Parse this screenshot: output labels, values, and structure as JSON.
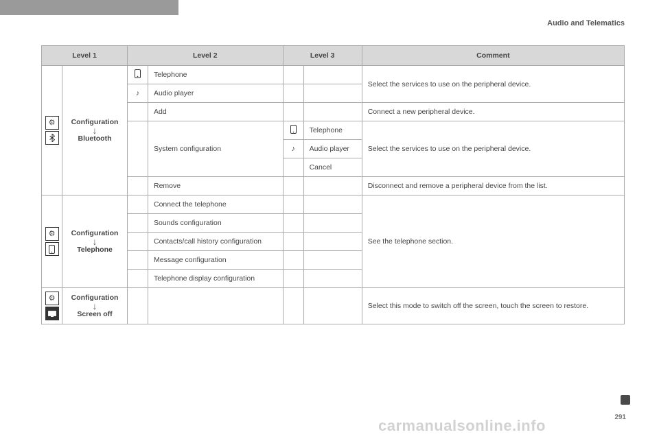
{
  "header": {
    "section": "Audio and Telematics"
  },
  "page_number": "291",
  "watermark": "carmanualsonline.info",
  "columns": {
    "c1": "Level 1",
    "c2": "Level 2",
    "c3": "Level 3",
    "c4": "Comment"
  },
  "groups": {
    "bt": {
      "label_top": "Configuration",
      "label_bottom": "Bluetooth",
      "icon_top": "gears-icon",
      "icon_bottom": "bluetooth-icon",
      "rows": {
        "r1": {
          "icon": "phone-icon",
          "label": "Telephone"
        },
        "r2": {
          "icon": "music-note-icon",
          "label": "Audio player"
        },
        "r3": {
          "label": "Add"
        },
        "r4": {
          "label": "System configuration",
          "sub": {
            "s1": {
              "icon": "phone-icon",
              "label": "Telephone"
            },
            "s2": {
              "icon": "music-note-icon",
              "label": "Audio player"
            },
            "s3": {
              "label": "Cancel"
            }
          }
        },
        "r5": {
          "label": "Remove"
        }
      },
      "comments": {
        "c1": "Select the services to use on the peripheral device.",
        "c2": "Connect a new peripheral device.",
        "c3": "Select the services to use on the peripheral device.",
        "c4": "Disconnect and remove a peripheral device from the list."
      }
    },
    "tel": {
      "label_top": "Configuration",
      "label_bottom": "Telephone",
      "icon_top": "gears-icon",
      "icon_bottom": "phone-icon",
      "rows": {
        "r1": {
          "label": "Connect the telephone"
        },
        "r2": {
          "label": "Sounds configuration"
        },
        "r3": {
          "label": "Contacts/call history configuration"
        },
        "r4": {
          "label": "Message configuration"
        },
        "r5": {
          "label": "Telephone display configuration"
        }
      },
      "comment": "See the telephone section."
    },
    "scr": {
      "label_top": "Configuration",
      "label_bottom": "Screen off",
      "icon_top": "gears-icon",
      "icon_bottom": "screen-icon",
      "comment": "Select this mode to switch off the screen, touch the screen to restore."
    }
  }
}
